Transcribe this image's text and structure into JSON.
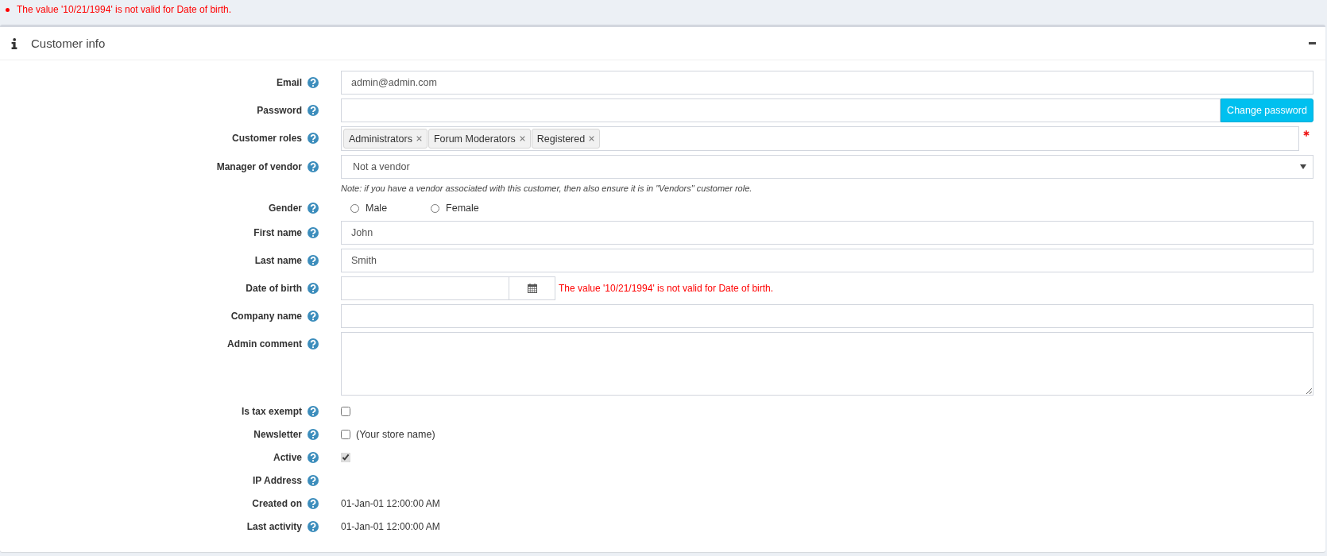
{
  "validation_summary": {
    "errors": [
      "The value '10/21/1994' is not valid for Date of birth."
    ]
  },
  "panel": {
    "title": "Customer info",
    "expanded": true
  },
  "fields": [
    {
      "kind": "text",
      "label": "Email",
      "value": "admin@admin.com"
    },
    {
      "kind": "password",
      "label": "Password",
      "button": "Change password"
    },
    {
      "kind": "tags",
      "label": "Customer roles",
      "tags": [
        "Administrators",
        "Forum Moderators",
        "Registered"
      ],
      "required": true
    },
    {
      "kind": "select",
      "label": "Manager of vendor",
      "value": "Not a vendor",
      "note": "Note: if you have a vendor associated with this customer, then also ensure it is in \"Vendors\" customer role."
    },
    {
      "kind": "radio",
      "label": "Gender",
      "options": [
        {
          "label": "Male",
          "selected": false
        },
        {
          "label": "Female",
          "selected": false
        }
      ]
    },
    {
      "kind": "text",
      "label": "First name",
      "value": "John"
    },
    {
      "kind": "text",
      "label": "Last name",
      "value": "Smith"
    },
    {
      "kind": "date",
      "label": "Date of birth",
      "error": "The value '10/21/1994' is not valid for Date of birth."
    },
    {
      "kind": "text",
      "label": "Company name"
    },
    {
      "kind": "textarea",
      "label": "Admin comment"
    },
    {
      "kind": "checkbox",
      "label": "Is tax exempt",
      "checked": false
    },
    {
      "kind": "checkbox",
      "label": "Newsletter",
      "checked": false,
      "caption": "(Your store name)"
    },
    {
      "kind": "checkbox",
      "label": "Active",
      "checked": true
    },
    {
      "kind": "static",
      "label": "IP Address"
    },
    {
      "kind": "static",
      "label": "Created on",
      "value": "01-Jan-01 12:00:00 AM"
    },
    {
      "kind": "static",
      "label": "Last activity",
      "value": "01-Jan-01 12:00:00 AM"
    }
  ]
}
